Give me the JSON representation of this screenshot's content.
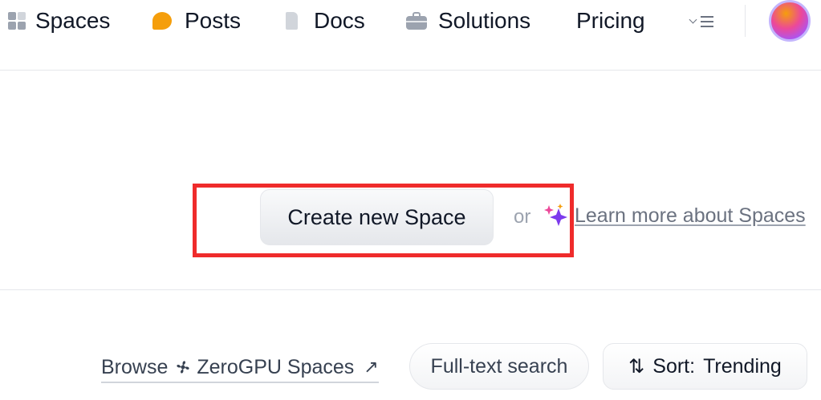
{
  "nav": {
    "items": [
      {
        "label": "Spaces",
        "icon": "spaces-grid-icon"
      },
      {
        "label": "Posts",
        "icon": "posts-bubble-icon"
      },
      {
        "label": "Docs",
        "icon": "docs-icon"
      },
      {
        "label": "Solutions",
        "icon": "briefcase-icon"
      },
      {
        "label": "Pricing"
      }
    ],
    "menu_icon": "chevron-menu-icon",
    "avatar": "user-avatar"
  },
  "create": {
    "button_label": "Create new Space",
    "or_text": "or",
    "learn_link": "Learn more about Spaces",
    "sparkles_icon": "sparkles-icon",
    "highlight_color": "#ef2b2b"
  },
  "filters": {
    "browse_prefix": "Browse",
    "browse_suffix": "ZeroGPU Spaces",
    "browse_icon": "fan-icon",
    "browse_arrow": "↗",
    "fulltext_label": "Full-text search",
    "sort_icon": "⇅",
    "sort_label": "Sort:",
    "sort_value": "Trending"
  },
  "colors": {
    "accent_posts": "#f59e0b",
    "link_gray": "#6b7280"
  }
}
